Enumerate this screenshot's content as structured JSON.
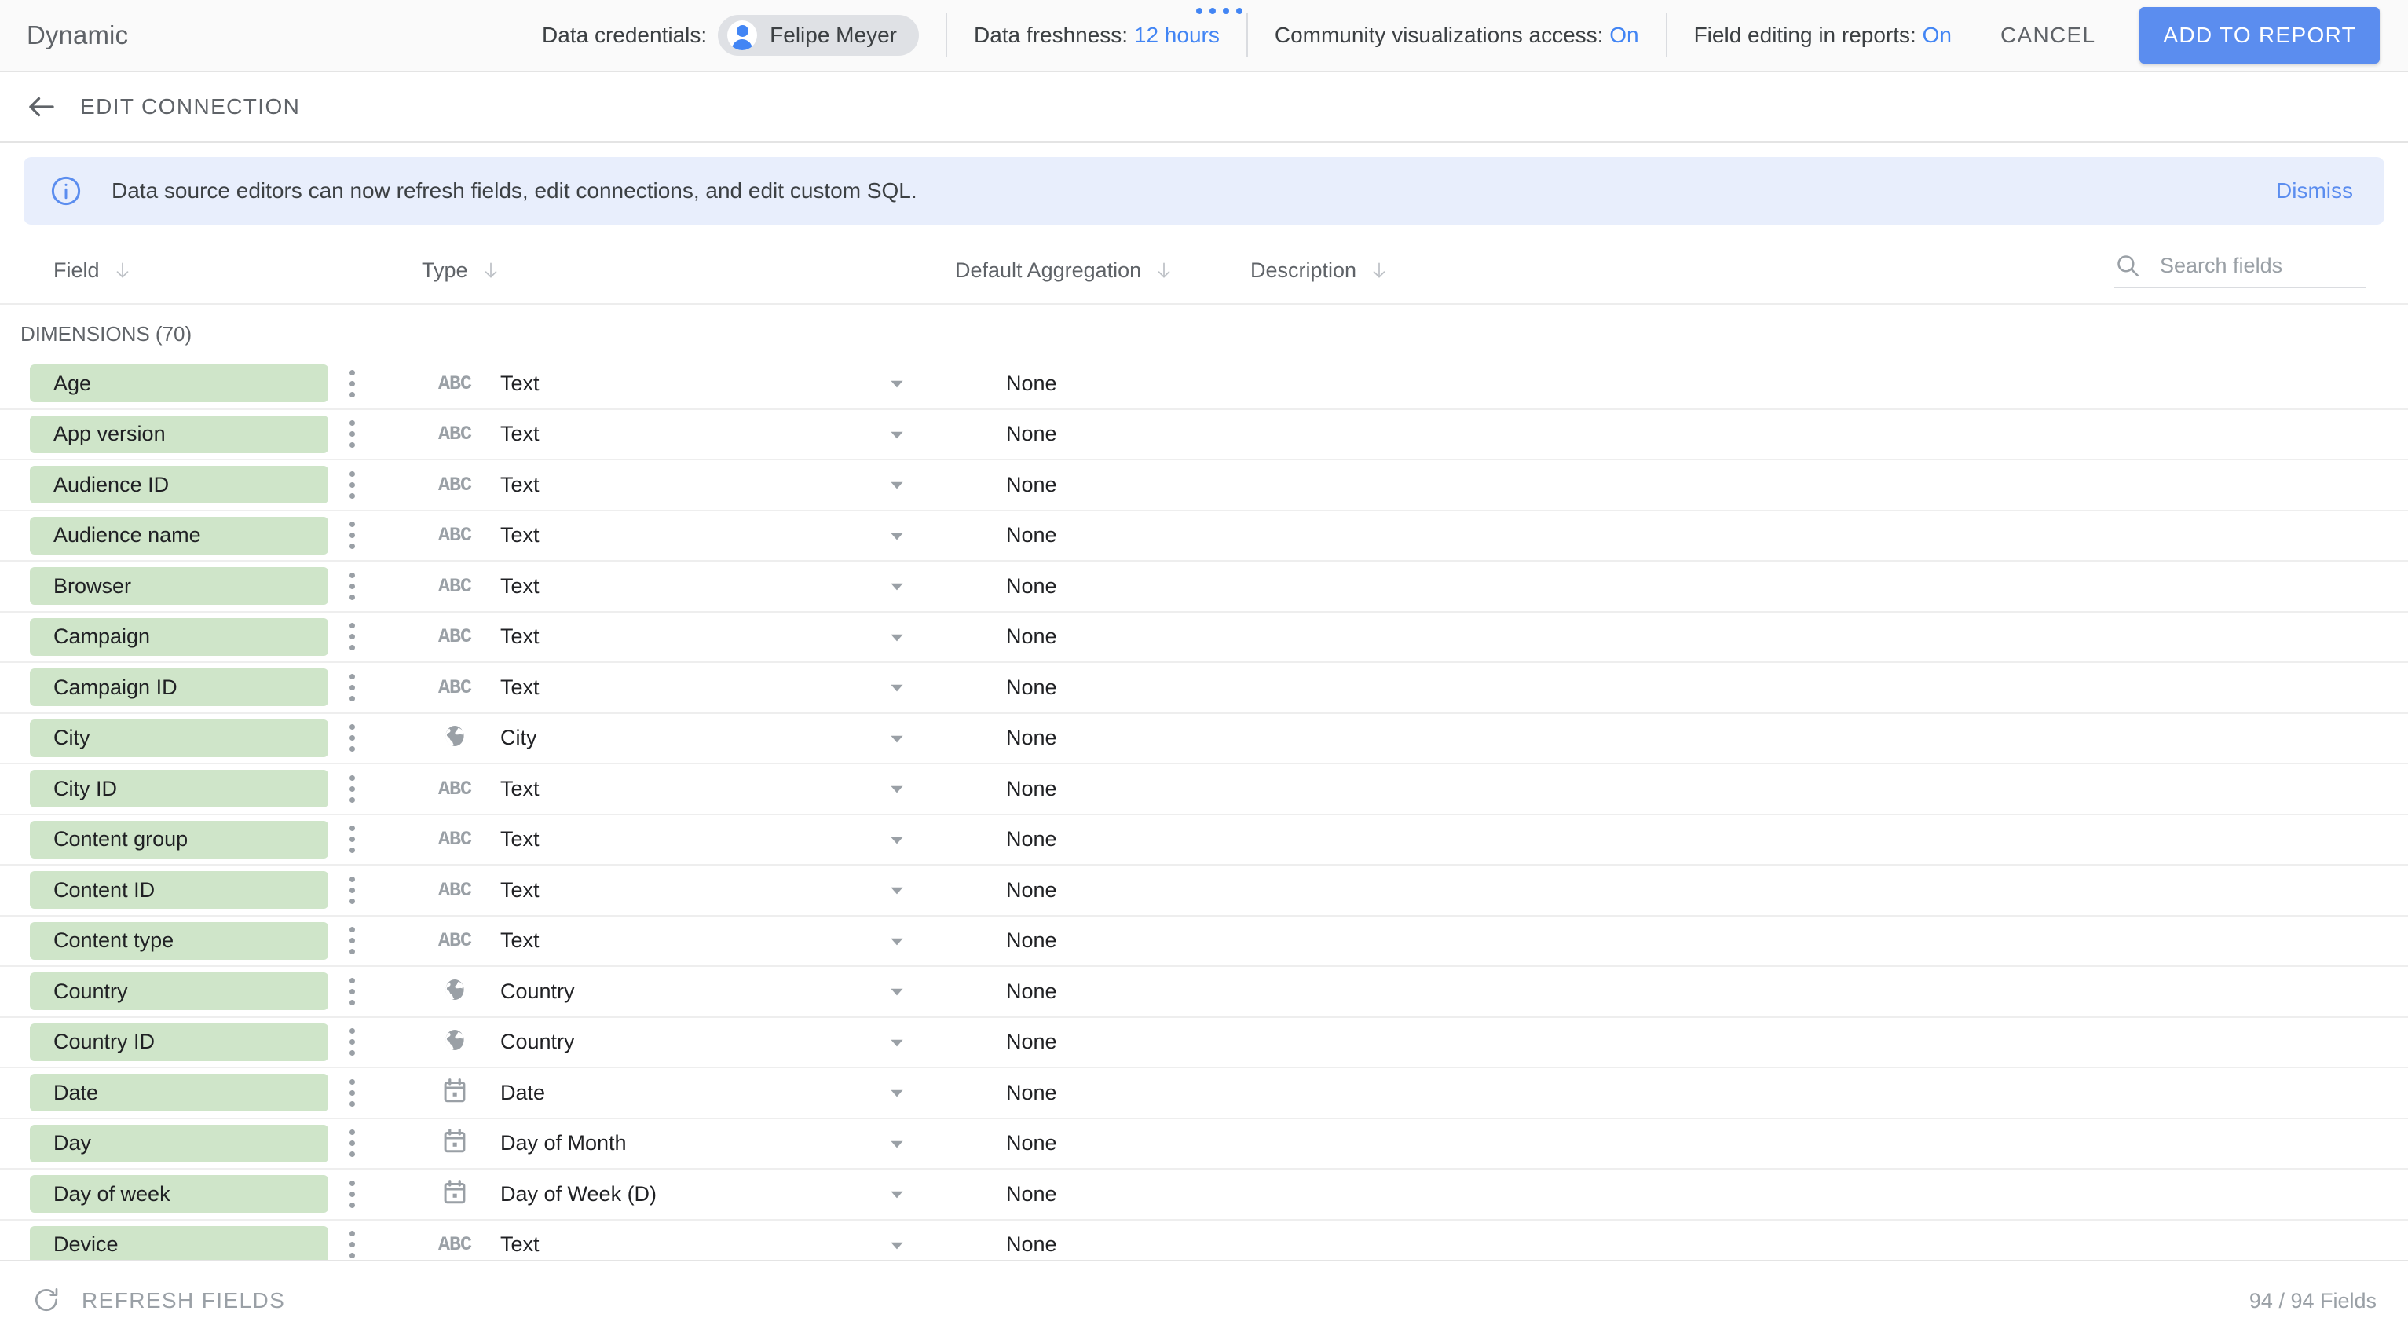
{
  "topbar": {
    "title": "Dynamic",
    "dots_count": 4,
    "credentials_label": "Data credentials:",
    "credentials_user": "Felipe Meyer",
    "credentials_avatar_icon": "person-icon",
    "freshness_label": "Data freshness:",
    "freshness_value": "12 hours",
    "community_label": "Community visualizations access:",
    "community_value": "On",
    "field_editing_label": "Field editing in reports:",
    "field_editing_value": "On",
    "cancel_label": "CANCEL",
    "add_to_report_label": "ADD TO REPORT",
    "accent_blue": "#4285f4",
    "button_blue": "#5b8def"
  },
  "editbar": {
    "back_icon": "arrow-left-icon",
    "label": "EDIT CONNECTION"
  },
  "banner": {
    "icon": "info-icon",
    "text": "Data source editors can now refresh fields, edit connections, and edit custom SQL.",
    "dismiss_label": "Dismiss",
    "background": "#e8eefc",
    "link_color": "#5b8def"
  },
  "columns": {
    "field": "Field",
    "type": "Type",
    "default_aggregation": "Default Aggregation",
    "description": "Description",
    "sort_icon": "arrow-down-icon"
  },
  "search": {
    "icon": "search-icon",
    "placeholder": "Search fields",
    "value": ""
  },
  "section": {
    "label": "DIMENSIONS (70)",
    "chip_color": "#cfe5c9"
  },
  "rows": [
    {
      "field": "Age",
      "type_icon": "abc-icon",
      "type": "Text",
      "aggregation": "None",
      "description": ""
    },
    {
      "field": "App version",
      "type_icon": "abc-icon",
      "type": "Text",
      "aggregation": "None",
      "description": ""
    },
    {
      "field": "Audience ID",
      "type_icon": "abc-icon",
      "type": "Text",
      "aggregation": "None",
      "description": ""
    },
    {
      "field": "Audience name",
      "type_icon": "abc-icon",
      "type": "Text",
      "aggregation": "None",
      "description": ""
    },
    {
      "field": "Browser",
      "type_icon": "abc-icon",
      "type": "Text",
      "aggregation": "None",
      "description": ""
    },
    {
      "field": "Campaign",
      "type_icon": "abc-icon",
      "type": "Text",
      "aggregation": "None",
      "description": ""
    },
    {
      "field": "Campaign ID",
      "type_icon": "abc-icon",
      "type": "Text",
      "aggregation": "None",
      "description": ""
    },
    {
      "field": "City",
      "type_icon": "globe-icon",
      "type": "City",
      "aggregation": "None",
      "description": ""
    },
    {
      "field": "City ID",
      "type_icon": "abc-icon",
      "type": "Text",
      "aggregation": "None",
      "description": ""
    },
    {
      "field": "Content group",
      "type_icon": "abc-icon",
      "type": "Text",
      "aggregation": "None",
      "description": ""
    },
    {
      "field": "Content ID",
      "type_icon": "abc-icon",
      "type": "Text",
      "aggregation": "None",
      "description": ""
    },
    {
      "field": "Content type",
      "type_icon": "abc-icon",
      "type": "Text",
      "aggregation": "None",
      "description": ""
    },
    {
      "field": "Country",
      "type_icon": "globe-icon",
      "type": "Country",
      "aggregation": "None",
      "description": ""
    },
    {
      "field": "Country ID",
      "type_icon": "globe-icon",
      "type": "Country",
      "aggregation": "None",
      "description": ""
    },
    {
      "field": "Date",
      "type_icon": "calendar-icon",
      "type": "Date",
      "aggregation": "None",
      "description": ""
    },
    {
      "field": "Day",
      "type_icon": "calendar-icon",
      "type": "Day of Month",
      "aggregation": "None",
      "description": ""
    },
    {
      "field": "Day of week",
      "type_icon": "calendar-icon",
      "type": "Day of Week (D)",
      "aggregation": "None",
      "description": ""
    },
    {
      "field": "Device",
      "type_icon": "abc-icon",
      "type": "Text",
      "aggregation": "None",
      "description": ""
    }
  ],
  "footer": {
    "refresh_icon": "refresh-icon",
    "refresh_label": "REFRESH FIELDS",
    "field_count": "94 / 94 Fields"
  }
}
